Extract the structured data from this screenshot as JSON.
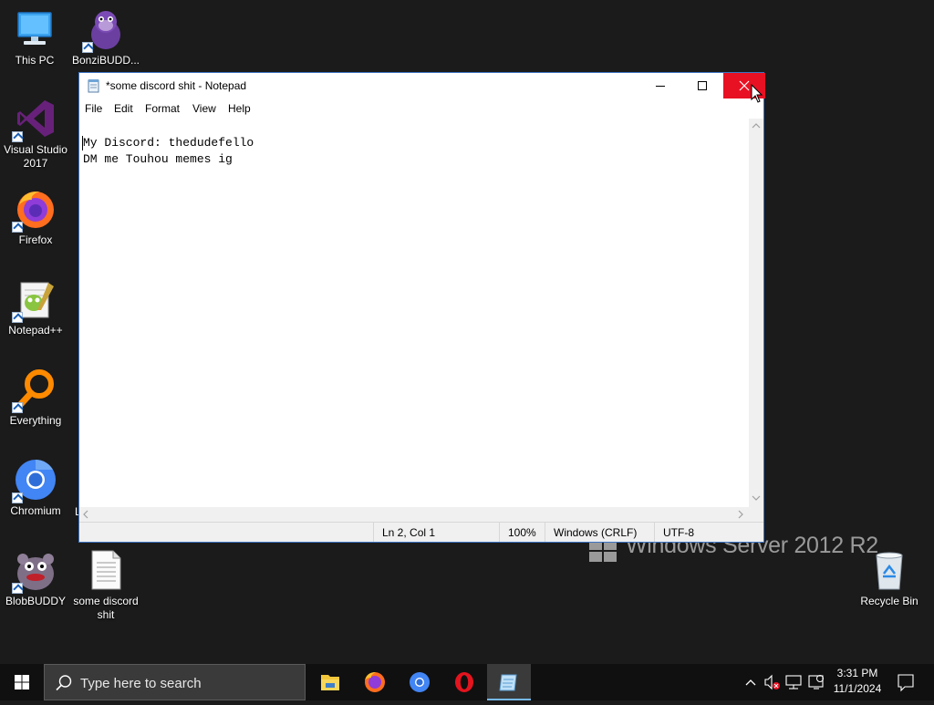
{
  "desktop": {
    "icons": [
      {
        "label": "This PC"
      },
      {
        "label": "BonziBUDD..."
      },
      {
        "label": "Visual Studio 2017"
      },
      {
        "label": "Firefox"
      },
      {
        "label": "Notepad++"
      },
      {
        "label": "Everything"
      },
      {
        "label": "Chromium"
      },
      {
        "label": "BlobBUDDY"
      },
      {
        "label": "some discord shit"
      },
      {
        "label": "Recycle Bin"
      }
    ],
    "watermark": "Windows Server 2012 R2"
  },
  "notepad": {
    "title": "*some discord shit - Notepad",
    "menu": [
      "File",
      "Edit",
      "Format",
      "View",
      "Help"
    ],
    "lines": [
      "My Discord: thedudefello",
      "DM me Touhou memes ig"
    ],
    "status": {
      "position": "Ln 2, Col 1",
      "zoom": "100%",
      "line_endings": "Windows (CRLF)",
      "encoding": "UTF-8"
    }
  },
  "taskbar": {
    "search_placeholder": "Type here to search",
    "apps": [
      "file-explorer",
      "firefox",
      "chromium",
      "opera",
      "notepad"
    ],
    "active_app": "notepad",
    "clock": {
      "time": "3:31 PM",
      "date": "11/1/2024"
    }
  },
  "colors": {
    "close_button": "#e81123",
    "window_border": "#3d75c3",
    "taskbar": "#101010",
    "desktop": "#1b1b1b"
  }
}
